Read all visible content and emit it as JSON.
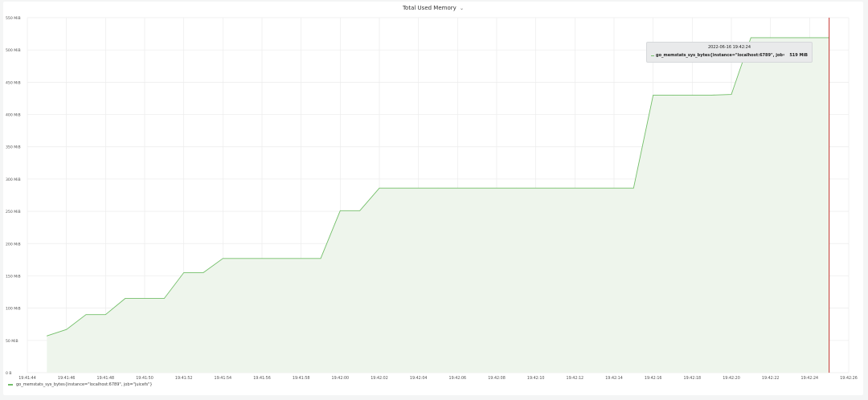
{
  "panel": {
    "title": "Total Used Memory",
    "title_chevron": "⌄"
  },
  "tooltip": {
    "time": "2022-06-16 19:42:24",
    "series_name": "go_memstats_sys_bytes{instance=\"localhost:6789\", job=\"juicefs\"}",
    "value": "519 MiB"
  },
  "legend": {
    "label": "go_memstats_sys_bytes{instance=\"localhost:6789\", job=\"juicefs\"}"
  },
  "colors": {
    "series": "#73bf69",
    "fill": "#eef5ec",
    "cursor": "#c4312d",
    "grid": "#ececec"
  },
  "chart_data": {
    "type": "area",
    "title": "Total Used Memory",
    "xlabel": "",
    "ylabel": "",
    "x_ticks": [
      "19:41:44",
      "19:41:46",
      "19:41:48",
      "19:41:50",
      "19:41:52",
      "19:41:54",
      "19:41:56",
      "19:41:58",
      "19:42:00",
      "19:42:02",
      "19:42:04",
      "19:42:06",
      "19:42:08",
      "19:42:10",
      "19:42:12",
      "19:42:14",
      "19:42:16",
      "19:42:18",
      "19:42:20",
      "19:42:22",
      "19:42:24",
      "19:42:26"
    ],
    "y_ticks": [
      "0 B",
      "50 MiB",
      "100 MiB",
      "150 MiB",
      "200 MiB",
      "250 MiB",
      "300 MiB",
      "350 MiB",
      "400 MiB",
      "450 MiB",
      "500 MiB",
      "550 MiB"
    ],
    "ylim": [
      0,
      550
    ],
    "xlim": [
      "19:41:44",
      "19:42:26"
    ],
    "grid": true,
    "legend_position": "bottom-left",
    "series": [
      {
        "name": "go_memstats_sys_bytes{instance=\"localhost:6789\", job=\"juicefs\"}",
        "x": [
          "19:41:45",
          "19:41:46",
          "19:41:47",
          "19:41:48",
          "19:41:49",
          "19:41:50",
          "19:41:51",
          "19:41:52",
          "19:41:53",
          "19:41:54",
          "19:41:55",
          "19:41:56",
          "19:41:57",
          "19:41:58",
          "19:41:59",
          "19:42:00",
          "19:42:01",
          "19:42:02",
          "19:42:03",
          "19:42:04",
          "19:42:05",
          "19:42:06",
          "19:42:07",
          "19:42:08",
          "19:42:09",
          "19:42:10",
          "19:42:11",
          "19:42:12",
          "19:42:13",
          "19:42:14",
          "19:42:15",
          "19:42:16",
          "19:42:17",
          "19:42:18",
          "19:42:19",
          "19:42:20",
          "19:42:21",
          "19:42:22",
          "19:42:23",
          "19:42:24",
          "19:42:25"
        ],
        "values": [
          57,
          67,
          90,
          90,
          115,
          115,
          115,
          155,
          155,
          177,
          177,
          177,
          177,
          177,
          177,
          251,
          251,
          286,
          286,
          286,
          286,
          286,
          286,
          286,
          286,
          286,
          286,
          286,
          286,
          286,
          286,
          430,
          430,
          430,
          430,
          431,
          519,
          519,
          519,
          519,
          519
        ]
      }
    ],
    "cursor_time": "19:42:25"
  }
}
